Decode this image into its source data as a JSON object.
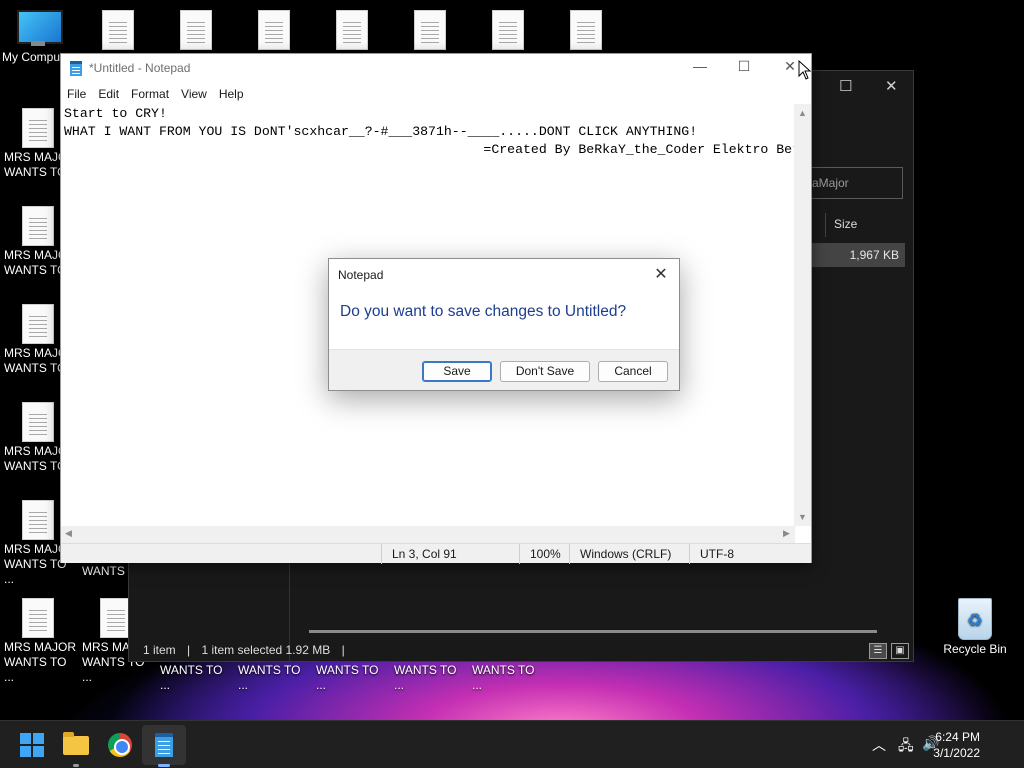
{
  "desktop": {
    "my_computer_label": "My Compu",
    "file_label_1": "MRS MAJOR",
    "file_label_2": "WANTS TO",
    "file_label_trunc": "WANTS TO ...",
    "recycle_bin_label": "Recycle Bin"
  },
  "explorer": {
    "search_placeholder": "aMajor",
    "size_header": "Size",
    "size_value": "1,967 KB",
    "status_items": "1 item",
    "status_selected": "1 item selected  1.92 MB"
  },
  "notepad": {
    "title": "*Untitled - Notepad",
    "menu": [
      "File",
      "Edit",
      "Format",
      "View",
      "Help"
    ],
    "content_line1": "Start to CRY!",
    "content_line2": "WHAT I WANT FROM YOU IS DoNT'scxhcar__?-#___3871h--____.....DONT CLICK ANYTHING!",
    "content_line3": "                                                     =Created By BeRkaY_the_Coder Elektro Berkay=",
    "status": {
      "position": "Ln 3, Col 91",
      "zoom": "100%",
      "line_endings": "Windows (CRLF)",
      "encoding": "UTF-8"
    }
  },
  "dialog": {
    "title": "Notepad",
    "message": "Do you want to save changes to Untitled?",
    "save_label": "Save",
    "dont_save_label": "Don't Save",
    "cancel_label": "Cancel"
  },
  "taskbar": {
    "time": "6:24 PM",
    "date": "3/1/2022"
  },
  "colors": {
    "dialog_message": "#1d3d8f",
    "taskbar_bg": "#202020",
    "accent": "#3a78c9"
  }
}
